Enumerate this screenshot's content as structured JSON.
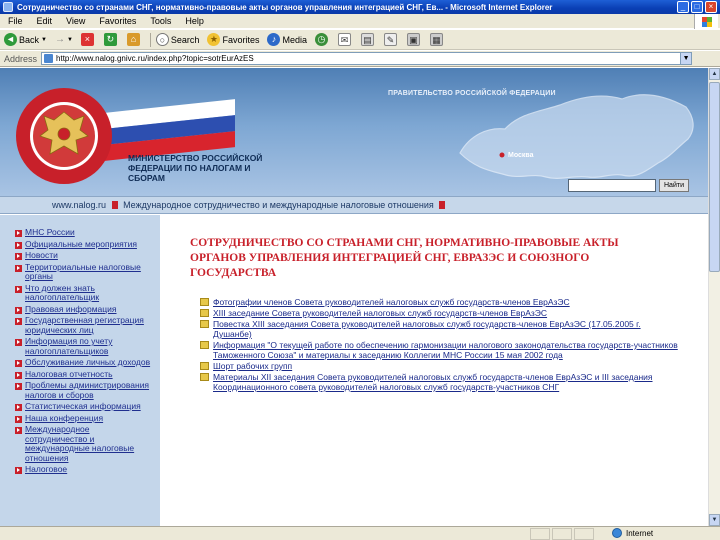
{
  "window": {
    "title": "Сотрудничество со странами СНГ, нормативно-правовые акты органов управления интеграцией СНГ, Ев... - Microsoft Internet Explorer"
  },
  "menubar": {
    "items": [
      "File",
      "Edit",
      "View",
      "Favorites",
      "Tools",
      "Help"
    ]
  },
  "toolbar": {
    "back": "Back",
    "search": "Search",
    "favorites": "Favorites",
    "media": "Media"
  },
  "addressbar": {
    "label": "Address",
    "url": "http://www.nalog.gnivc.ru/index.php?topic=sotrEurAzES"
  },
  "header": {
    "gov_label": "ПРАВИТЕЛЬСТВО РОССИЙСКОЙ ФЕДЕРАЦИИ",
    "ministry": "МИНИСТЕРСТВО РОССИЙСКОЙ ФЕДЕРАЦИИ ПО НАЛОГАМ И СБОРАМ",
    "search_button": "Найти"
  },
  "breadcrumb": {
    "home": "www.nalog.ru",
    "section": "Международное сотрудничество и международные налоговые отношения"
  },
  "leftnav": {
    "items": [
      "МНС России",
      "Официальные мероприятия",
      "Новости",
      "Территориальные налоговые органы",
      "Что должен знать налогоплательщик",
      "Правовая информация",
      "Государственная регистрация юридических лиц",
      "Информация по учету налогоплательщиков",
      "Обслуживание личных доходов",
      "Налоговая отчетность",
      "Проблемы администрирования налогов и сборов",
      "Статистическая информация",
      "Наша конференция",
      "Международное сотрудничество и международные налоговые отношения",
      "Налоговое"
    ]
  },
  "main": {
    "heading": "Сотрудничество со странами СНГ, нормативно-правовые акты органов управления интеграцией СНГ, ЕврАзЭС и Союзного государства",
    "links": [
      "Фотографии членов Совета руководителей налоговых служб государств-членов ЕврАзЭС",
      "XIII заседание Совета руководителей налоговых служб государств-членов ЕврАзЭС",
      "Повестка XIII заседания Совета руководителей налоговых служб государств-членов ЕврАзЭС (17.05.2005 г. Душанбе)",
      "Информация \"О текущей работе по обеспечению гармонизации налогового законодательства государств-участников Таможенного Союза\" и материалы к заседанию Коллегии МНС России 15 мая 2002 года",
      "Шорт рабочих групп",
      "Материалы XII заседания Совета руководителей налоговых служб государств-членов ЕврАзЭС и III заседания Координационного совета руководителей налоговых служб государств-участников СНГ"
    ]
  },
  "statusbar": {
    "zone": "Internet"
  }
}
